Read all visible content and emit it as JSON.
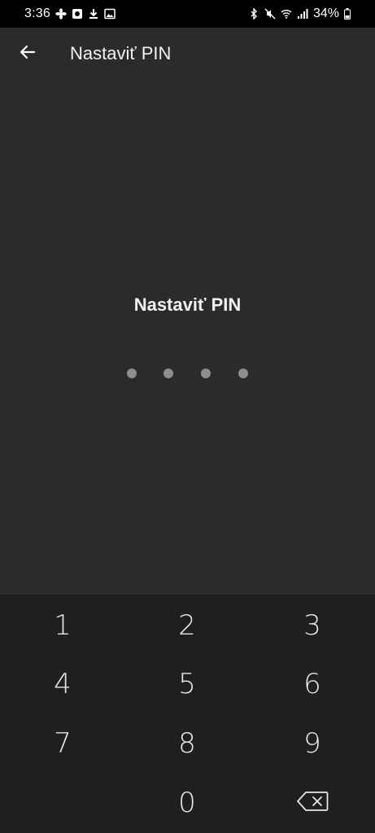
{
  "status_bar": {
    "time": "3:36",
    "battery": "34%",
    "left_icons": [
      "fan-icon",
      "notification-icon",
      "download-icon",
      "image-icon"
    ],
    "right_icons": [
      "bluetooth-icon",
      "mute-icon",
      "wifi-icon",
      "signal-icon",
      "battery-icon"
    ]
  },
  "app_bar": {
    "title": "Nastaviť PIN",
    "back_icon": "back-arrow-icon"
  },
  "main": {
    "prompt": "Nastaviť PIN",
    "pin_length": 4,
    "entered_digits": 0
  },
  "keypad": {
    "keys": [
      "1",
      "2",
      "3",
      "4",
      "5",
      "6",
      "7",
      "8",
      "9",
      "0"
    ],
    "backspace_icon": "backspace-icon"
  },
  "colors": {
    "background": "#2b2b2b",
    "keypad_background": "#1f1f1f",
    "dot": "#8e8e8e",
    "text": "#ffffff"
  }
}
